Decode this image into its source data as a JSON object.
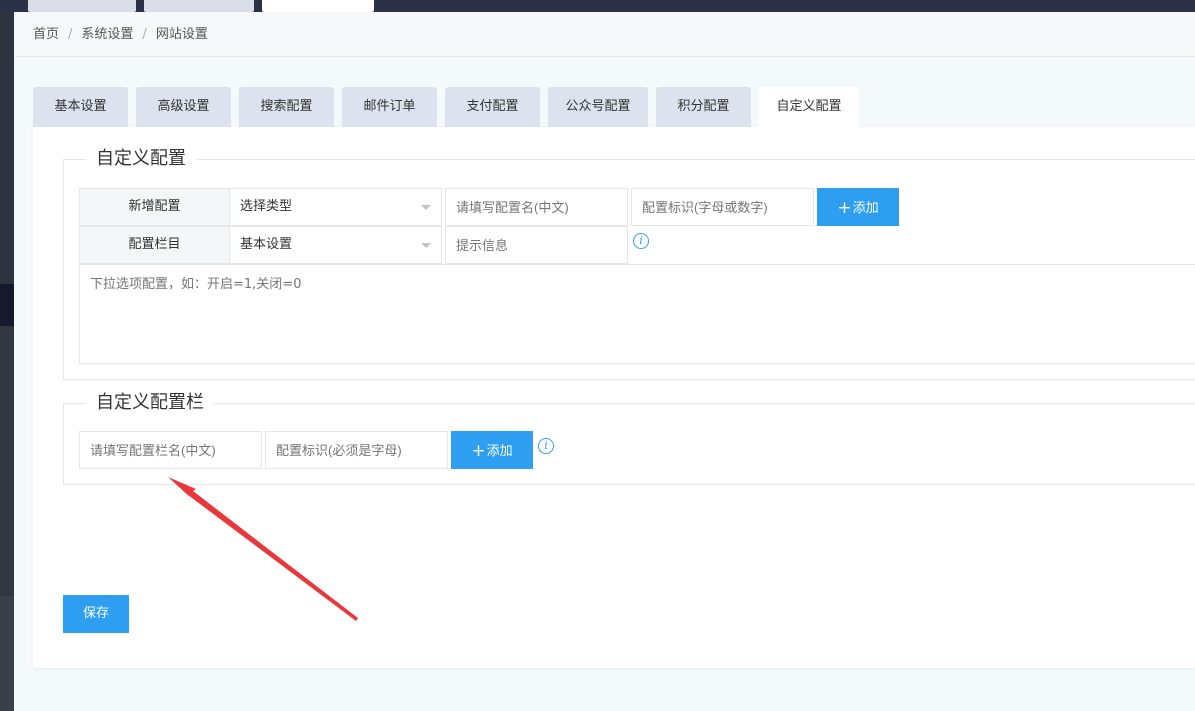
{
  "breadcrumb": {
    "items": [
      "首页",
      "系统设置",
      "网站设置"
    ],
    "separator": "/"
  },
  "tabs": [
    {
      "label": "基本设置"
    },
    {
      "label": "高级设置"
    },
    {
      "label": "搜索配置"
    },
    {
      "label": "邮件订单"
    },
    {
      "label": "支付配置"
    },
    {
      "label": "公众号配置"
    },
    {
      "label": "积分配置"
    },
    {
      "label": "自定义配置",
      "active": true
    }
  ],
  "custom_config": {
    "legend": "自定义配置",
    "add_label": "新增配置",
    "type_select": "选择类型",
    "name_placeholder": "请填写配置名(中文)",
    "key_placeholder": "配置标识(字母或数字)",
    "add_button": "添加",
    "section_label": "配置栏目",
    "section_select": "基本设置",
    "tip_placeholder": "提示信息",
    "options_placeholder": "下拉选项配置，如：开启=1,关闭=0"
  },
  "custom_section": {
    "legend": "自定义配置栏",
    "name_placeholder": "请填写配置栏名(中文)",
    "key_placeholder": "配置标识(必须是字母)",
    "add_button": "添加"
  },
  "save_button": "保存",
  "icons": {
    "plus": "+",
    "info": "i"
  },
  "colors": {
    "primary": "#2e9ff0",
    "annotation_arrow": "#e8383b",
    "tab_inactive": "#dde3ee",
    "topbar": "#2b3146"
  }
}
